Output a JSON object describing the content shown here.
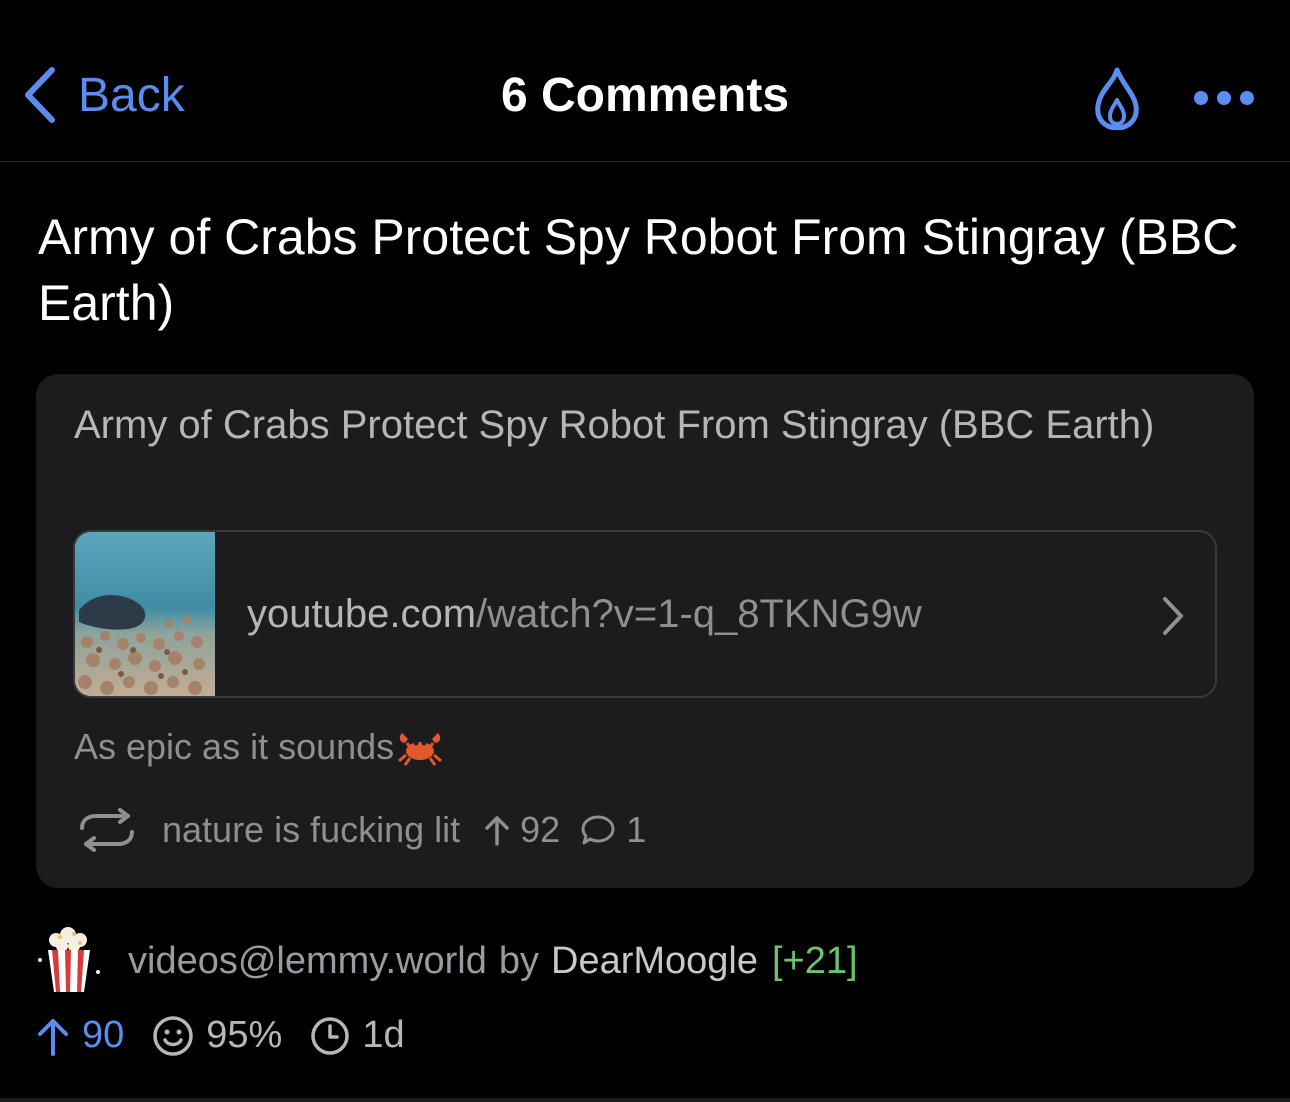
{
  "nav": {
    "back_label": "Back",
    "title": "6 Comments",
    "icons": [
      "chevron-left-icon",
      "flame-icon",
      "more-icon"
    ]
  },
  "post": {
    "title": "Army of Crabs Protect Spy Robot From Stingray (BBC Earth)"
  },
  "crosspost_card": {
    "title": "Army of Crabs Protect Spy Robot From Stingray (BBC Earth)",
    "link": {
      "domain": "youtube.com",
      "path": "/watch?v=1-q_8TKNG9w"
    },
    "caption": "As epic as it sounds",
    "community": "nature is fucking lit",
    "upvotes": "92",
    "comments": "1"
  },
  "meta": {
    "community": "videos@lemmy.world",
    "by_label": "by",
    "author": "DearMoogle",
    "author_karma": "[+21]",
    "upvotes": "90",
    "upvote_ratio": "95%",
    "age": "1d"
  },
  "colors": {
    "accent": "#5b8cf0",
    "background": "#000000",
    "card": "#1c1c1e",
    "karma": "#6cc46c",
    "muted": "#8e8e93"
  }
}
